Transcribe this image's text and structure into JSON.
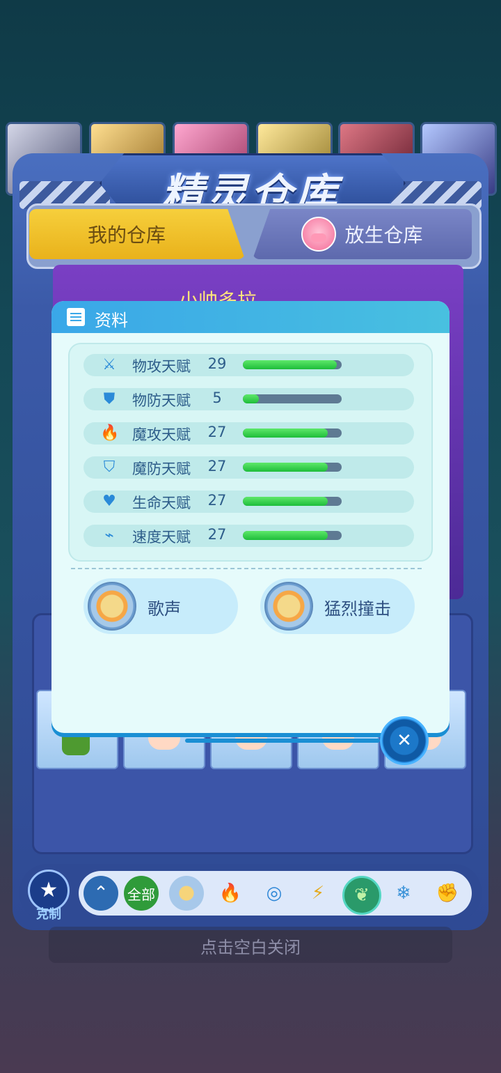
{
  "window": {
    "title": "精灵仓库",
    "tabs": [
      {
        "label": "我的仓库",
        "active": true
      },
      {
        "label": "放生仓库",
        "active": false
      }
    ],
    "pet_name": "小帅多拉",
    "close_hint": "点击空白关闭"
  },
  "info_panel": {
    "title": "资料",
    "stats": [
      {
        "name": "物攻天赋",
        "value": "29",
        "fill": 0.95,
        "icon": "sword-icon"
      },
      {
        "name": "物防天赋",
        "value": "5",
        "fill": 0.16,
        "icon": "shield-icon"
      },
      {
        "name": "魔攻天赋",
        "value": "27",
        "fill": 0.86,
        "icon": "flame-icon"
      },
      {
        "name": "魔防天赋",
        "value": "27",
        "fill": 0.86,
        "icon": "magic-shield-icon"
      },
      {
        "name": "生命天赋",
        "value": "27",
        "fill": 0.86,
        "icon": "heart-plus-icon"
      },
      {
        "name": "速度天赋",
        "value": "27",
        "fill": 0.86,
        "icon": "boot-icon"
      }
    ],
    "skills": [
      {
        "name": "歌声",
        "icon": "normal-type-icon"
      },
      {
        "name": "猛烈撞击",
        "icon": "normal-type-icon"
      }
    ]
  },
  "filter_bar": {
    "restrain_label": "克制",
    "all_label": "全部",
    "types": [
      "up-arrow-icon",
      "all",
      "normal-type-icon",
      "fire-type-icon",
      "water-type-icon",
      "electric-type-icon",
      "grass-type-icon",
      "ice-type-icon",
      "fighting-type-icon"
    ]
  },
  "colors": {
    "accent": "#3aa7e8",
    "bar_fill": "#1ebd3a",
    "bar_track": "#5e7a93",
    "tab_active": "#e9b21b"
  }
}
